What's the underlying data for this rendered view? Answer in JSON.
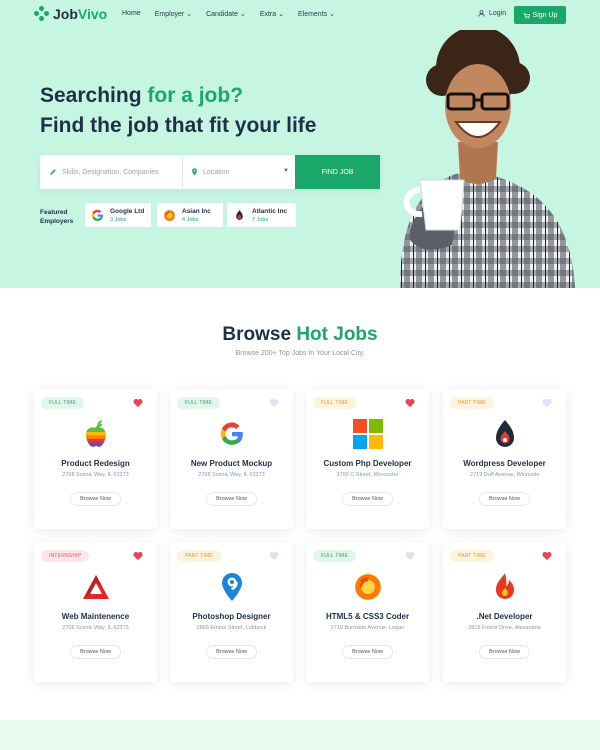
{
  "brand": {
    "part1": "Job",
    "part2": "Vivo"
  },
  "nav": {
    "items": [
      "Home",
      "Employer ⌄",
      "Candidate ⌄",
      "Extra ⌄",
      "Elements ⌄"
    ],
    "login": "Login",
    "signup": "Sign Up"
  },
  "hero": {
    "line1_a": "Searching ",
    "line1_b": "for a job?",
    "line2": "Find the job that fit your life",
    "search": {
      "keyword_placeholder": "Skills, Designation, Companies",
      "location_placeholder": "Location",
      "button": "FIND JOB"
    },
    "featured_label_1": "Featured",
    "featured_label_2": "Employers",
    "employers": [
      {
        "name": "Google Ltd",
        "count": "3 Jobs",
        "icon": "google-icon"
      },
      {
        "name": "Asian Inc",
        "count": "4 Jobs",
        "icon": "firefox-icon"
      },
      {
        "name": "Atlantic Inc",
        "count": "7 Jobs",
        "icon": "flame-icon"
      }
    ]
  },
  "browse": {
    "title_a": "Browse ",
    "title_b": "Hot Jobs",
    "subtitle": "Browse 200+ Top Jobs In Your Local City."
  },
  "jobs": [
    {
      "type": "FULL TIME",
      "title": "Product Redesign",
      "address": "2708 Scenic Way, IL 62373",
      "button": "Browse Now",
      "icon": "apple-icon",
      "favorite": true
    },
    {
      "type": "FULL TIME",
      "title": "New Product Mockup",
      "address": "2708 Scenic Way, IL 62373",
      "button": "Browse Now",
      "icon": "google-icon",
      "favorite": false
    },
    {
      "type": "FULL TIME",
      "title": "Custom Php Developer",
      "address": "3765 C Street, Worcester",
      "button": "Browse Now",
      "icon": "windows-icon",
      "favorite": true
    },
    {
      "type": "PART TIME",
      "title": "Wordpress Developer",
      "address": "2719 Duff Avenue, Winooski",
      "button": "Browse Now",
      "icon": "flame-icon",
      "favorite": false
    },
    {
      "type": "INTERNSHIP",
      "title": "Web Maintenence",
      "address": "2708 Scenic Way, IL 62373",
      "button": "Browse Now",
      "icon": "triangle-logo-icon",
      "favorite": true
    },
    {
      "type": "PART TIME",
      "title": "Photoshop Designer",
      "address": "2865 Emma Street, Lubbock",
      "button": "Browse Now",
      "icon": "location-nine-icon",
      "favorite": false
    },
    {
      "type": "FULL TIME",
      "title": "HTML5 & CSS3 Coder",
      "address": "2719 Burnside Avenue, Logan",
      "button": "Browse Now",
      "icon": "firefox-icon",
      "favorite": false
    },
    {
      "type": "PART TIME",
      "title": ".Net Developer",
      "address": "3815 Forest Drive, Alexandria",
      "button": "Browse Now",
      "icon": "fire-icon",
      "favorite": true
    }
  ],
  "colors": {
    "accent": "#19a86a",
    "hero_bg": "#c6f5e2",
    "heart_on": "#e8445a",
    "heart_off": "#dde3f0"
  }
}
